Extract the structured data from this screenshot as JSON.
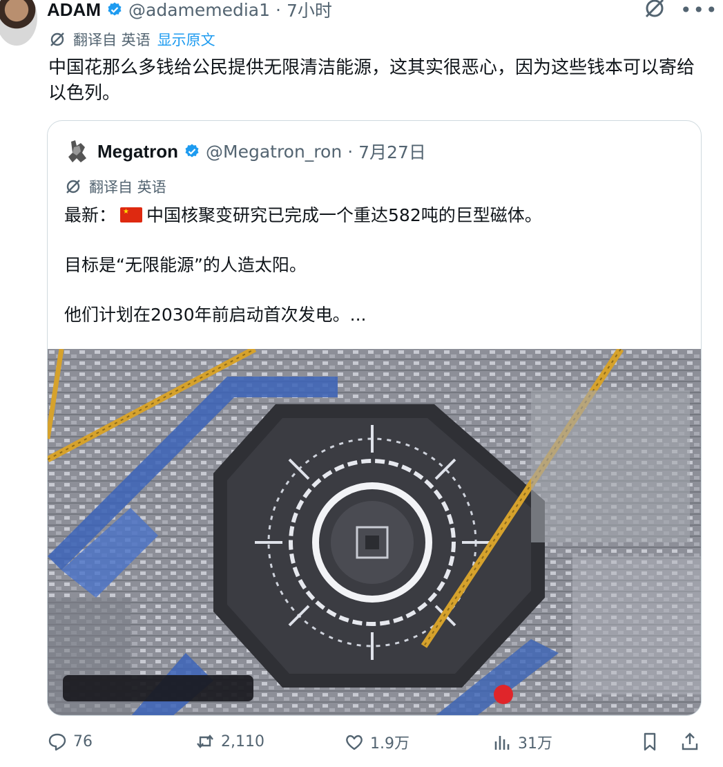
{
  "post": {
    "author_name": "ADAM",
    "author_handle": "@adamemedia1",
    "separator": "·",
    "time": "7小时",
    "translation_label": "翻译自 英语",
    "show_original": "显示原文",
    "text": "中国花那么多钱给公民提供无限清洁能源，这其实很恶心，因为这些钱本可以寄给以色列。"
  },
  "quote": {
    "author_name": "Megatron",
    "author_handle": "@Megatron_ron",
    "separator": "·",
    "date": "7月27日",
    "translation_label": "翻译自 英语",
    "line1_prefix": "最新：",
    "line1_rest": "中国核聚变研究已完成一个重达582吨的巨型磁体。",
    "line2": "目标是“无限能源”的人造太阳。",
    "line3": "他们计划在2030年前启动首次发电。..."
  },
  "actions": {
    "replies": "76",
    "reposts": "2,110",
    "likes": "1.9万",
    "views": "31万"
  },
  "colors": {
    "accent": "#1d9bf0",
    "muted": "#536471",
    "border": "#cfd9de"
  },
  "icons": [
    "verified-badge-icon",
    "grok-icon",
    "more-icon",
    "translate-icon",
    "reply-icon",
    "repost-icon",
    "like-icon",
    "views-icon",
    "bookmark-icon",
    "share-icon"
  ]
}
